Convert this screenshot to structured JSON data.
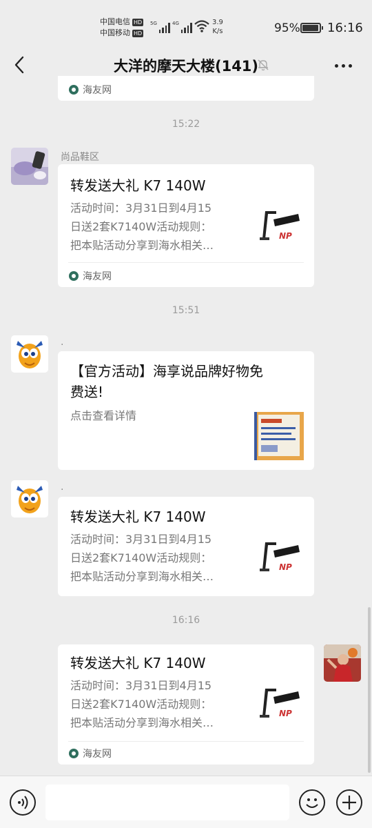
{
  "status_bar": {
    "carrier_1": "中国电信",
    "carrier_2": "中国移动",
    "hd_badge": "HD",
    "signal_1_label": "5G",
    "signal_2_label": "4G",
    "net_speed_value": "3.9",
    "net_speed_unit": "K/s",
    "battery_percent": "95%",
    "time": "16:16"
  },
  "header": {
    "title": "大洋的摩天大楼(141)"
  },
  "messages": {
    "top_partial_source": "海友网",
    "ts1": "15:22",
    "msg1": {
      "sender": "尚品鞋区",
      "title": "转发送大礼 K7 140W",
      "desc": [
        "活动时间：3月31日到4月15",
        "日送2套K7140W活动规则：",
        "把本贴活动分享到海水相关…"
      ],
      "source": "海友网"
    },
    "ts2": "15:51",
    "msg2": {
      "sender": ".",
      "title_lines": [
        "【官方活动】海享说品牌好物免",
        "费送!"
      ],
      "desc": "点击查看详情"
    },
    "msg3": {
      "sender": ".",
      "title": "转发送大礼 K7 140W",
      "desc": [
        "活动时间：3月31日到4月15",
        "日送2套K7140W活动规则：",
        "把本贴活动分享到海水相关…"
      ]
    },
    "ts3": "16:16",
    "msg4": {
      "title": "转发送大礼 K7 140W",
      "desc": [
        "活动时间：3月31日到4月15",
        "日送2套K7140W活动规则：",
        "把本贴活动分享到海水相关…"
      ],
      "source": "海友网"
    }
  },
  "icons": {
    "back": "chevron-left-icon",
    "mute": "bell-off-icon",
    "more": "more-dots-icon",
    "voice": "voice-icon",
    "emoji": "emoji-icon",
    "plus": "plus-icon"
  },
  "colors": {
    "background": "#ededed",
    "card": "#ffffff",
    "timestamp": "#9a9a9a",
    "link_source": "#2f6f5e"
  }
}
